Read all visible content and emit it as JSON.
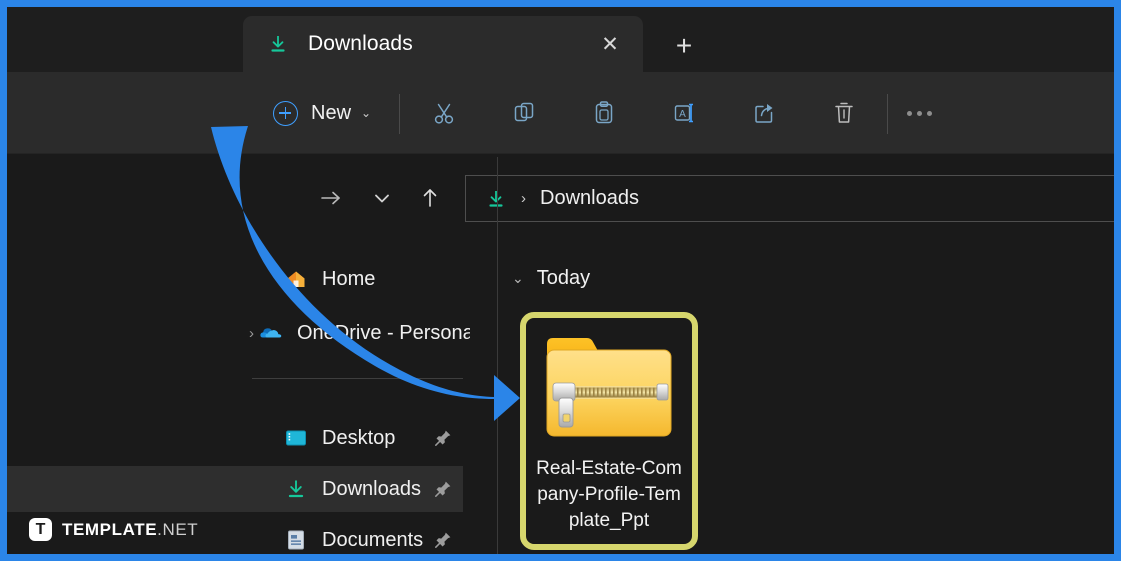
{
  "theme": {
    "frame_accent": "#2b85e8",
    "tabstrip_bg": "#1e1e1e",
    "toolbar_bg": "#2b2b2b",
    "content_bg": "#1a1a1a",
    "selection_highlight": "#d6d66d",
    "download_icon_green": "#16c79a",
    "arrow_blue": "#2b85e8"
  },
  "tabs": {
    "active": {
      "title": "Downloads",
      "icon": "download-icon",
      "close_label": "✕"
    },
    "new_tab_label": "+"
  },
  "toolbar": {
    "new_label": "New",
    "new_chevron": "⌄",
    "buttons": [
      {
        "name": "cut-button",
        "icon": "scissors-icon"
      },
      {
        "name": "copy-button",
        "icon": "copy-icon"
      },
      {
        "name": "paste-button",
        "icon": "clipboard-icon"
      },
      {
        "name": "rename-button",
        "icon": "rename-icon"
      },
      {
        "name": "share-button",
        "icon": "share-icon"
      },
      {
        "name": "delete-button",
        "icon": "trash-icon"
      }
    ],
    "more_label": "See more"
  },
  "navbar": {
    "forward_icon": "arrow-right-icon",
    "recent_icon": "chevron-down-icon",
    "up_icon": "arrow-up-icon",
    "address": {
      "icon": "download-icon",
      "separator": "›",
      "crumb": "Downloads"
    }
  },
  "sidebar": {
    "items": [
      {
        "label": "Home",
        "icon": "home-icon",
        "expander": "",
        "pinned": false,
        "selected": false
      },
      {
        "label": "OneDrive - Personal",
        "icon": "onedrive-icon",
        "expander": "›",
        "pinned": false,
        "selected": false
      },
      {
        "label": "Desktop",
        "icon": "desktop-icon",
        "expander": "",
        "pinned": true,
        "selected": false
      },
      {
        "label": "Downloads",
        "icon": "download-icon",
        "expander": "",
        "pinned": true,
        "selected": true
      },
      {
        "label": "Documents",
        "icon": "documents-icon",
        "expander": "",
        "pinned": true,
        "selected": false
      }
    ]
  },
  "content": {
    "group": {
      "label": "Today",
      "chevron": "⌄"
    },
    "files": [
      {
        "name": "Real-Estate-Company-Profile-Template_Ppt",
        "icon": "zip-folder-icon",
        "selected": true
      }
    ]
  },
  "annotation": {
    "arrow": "curved-blue-arrow",
    "points_to": "Downloads"
  },
  "watermark": {
    "logo_letter": "T",
    "name": "TEMPLATE",
    "tld": ".NET"
  }
}
